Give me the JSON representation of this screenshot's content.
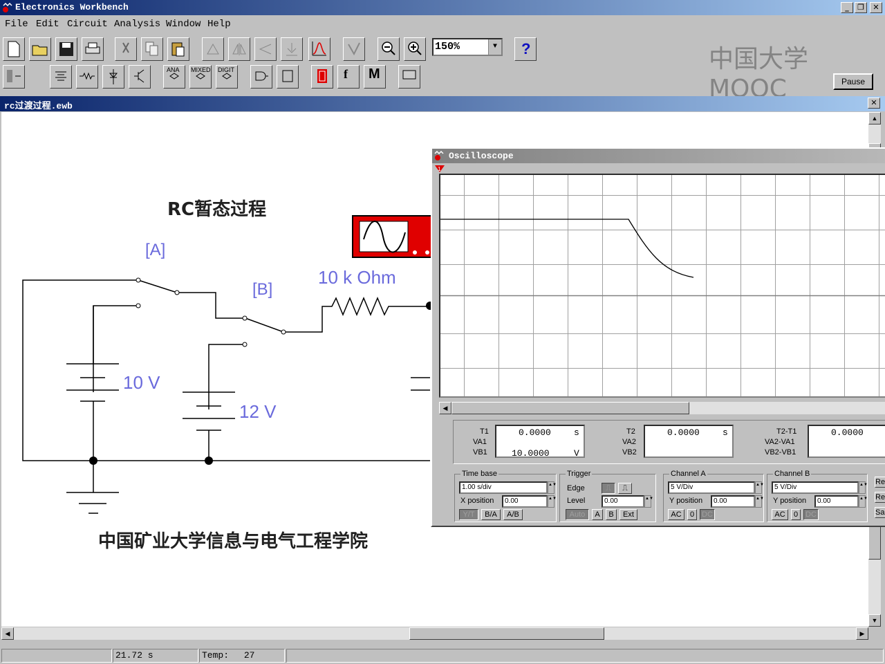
{
  "app": {
    "title": "Electronics Workbench"
  },
  "menu": [
    "File",
    "Edit",
    "Circuit",
    "Analysis",
    "Window",
    "Help"
  ],
  "toolbar": {
    "zoom": "150%",
    "help": "?",
    "pause": "Pause",
    "ana": "ANA",
    "mixed": "MIXED",
    "digit": "DIGIT",
    "m": "M",
    "f": "f"
  },
  "watermark": "中国大学MOOC",
  "document": {
    "title": "rc过渡过程.ewb"
  },
  "circuit": {
    "heading": "RC暂态过程",
    "switch_a": "[A]",
    "switch_b": "[B]",
    "resistor": "10 k Ohm",
    "battery1": "10 V",
    "battery2": "12 V",
    "footer": "中国矿业大学信息与电气工程学院"
  },
  "oscilloscope": {
    "title": "Oscilloscope",
    "readout": {
      "t1_label": "T1",
      "va1_label": "VA1",
      "vb1_label": "VB1",
      "t1_value": "0.0000",
      "t1_unit": "s",
      "vb1_value": "10.0000",
      "vb1_unit": "V",
      "t2_label": "T2",
      "va2_label": "VA2",
      "vb2_label": "VB2",
      "t2_value": "0.0000",
      "t2_unit": "s",
      "diff_t_label": "T2-T1",
      "diff_va_label": "VA2-VA1",
      "diff_vb_label": "VB2-VB1",
      "diff_value": "0.0000"
    },
    "timebase": {
      "label": "Time base",
      "value": "1.00 s/div",
      "xpos_label": "X position",
      "xpos_value": "0.00",
      "btn_yt": "Y/T",
      "btn_ba": "B/A",
      "btn_ab": "A/B"
    },
    "trigger": {
      "label": "Trigger",
      "edge_label": "Edge",
      "level_label": "Level",
      "level_value": "0.00",
      "btn_auto": "Auto",
      "btn_a": "A",
      "btn_b": "B",
      "btn_ext": "Ext"
    },
    "channel_a": {
      "label": "Channel A",
      "value": "5 V/Div",
      "ypos_label": "Y position",
      "ypos_value": "0.00",
      "btn_ac": "AC",
      "btn_0": "0",
      "btn_dc": "DC"
    },
    "channel_b": {
      "label": "Channel B",
      "value": "5 V/Div",
      "ypos_label": "Y position",
      "ypos_value": "0.00",
      "btn_ac": "AC",
      "btn_0": "0",
      "btn_dc": "DC"
    },
    "side_buttons": [
      "Re",
      "Re",
      "Sa"
    ]
  },
  "status": {
    "time": "21.72 s",
    "temp_label": "Temp:",
    "temp_value": "27"
  },
  "colors": {
    "titlebar": "#0a246a",
    "label_blue": "#6a6adc",
    "screen_trace": "#000000",
    "instrument_red": "#e00000"
  }
}
